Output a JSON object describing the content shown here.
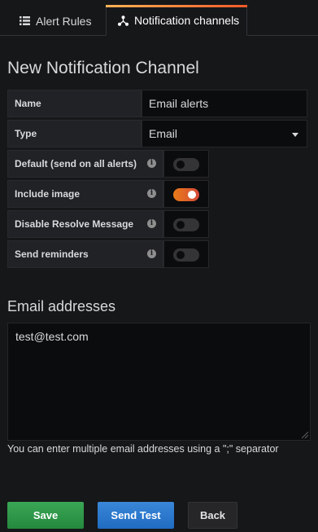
{
  "tabs": [
    {
      "label": "Alert Rules",
      "icon": "list-icon",
      "active": false
    },
    {
      "label": "Notification channels",
      "icon": "share-nodes-icon",
      "active": true
    }
  ],
  "page_title": "New Notification Channel",
  "form": {
    "name": {
      "label": "Name",
      "value": "Email alerts"
    },
    "type": {
      "label": "Type",
      "value": "Email"
    },
    "toggles": [
      {
        "label": "Default (send on all alerts)",
        "on": false
      },
      {
        "label": "Include image",
        "on": true
      },
      {
        "label": "Disable Resolve Message",
        "on": false
      },
      {
        "label": "Send reminders",
        "on": false
      }
    ]
  },
  "email": {
    "section_title": "Email addresses",
    "addresses": "test@test.com",
    "help": "You can enter multiple email addresses using a \";\" separator"
  },
  "buttons": {
    "save": "Save",
    "send_test": "Send Test",
    "back": "Back"
  },
  "colors": {
    "save": "#299c46",
    "send_test": "#1f78c1",
    "toggle_on": "#eb7b18"
  }
}
